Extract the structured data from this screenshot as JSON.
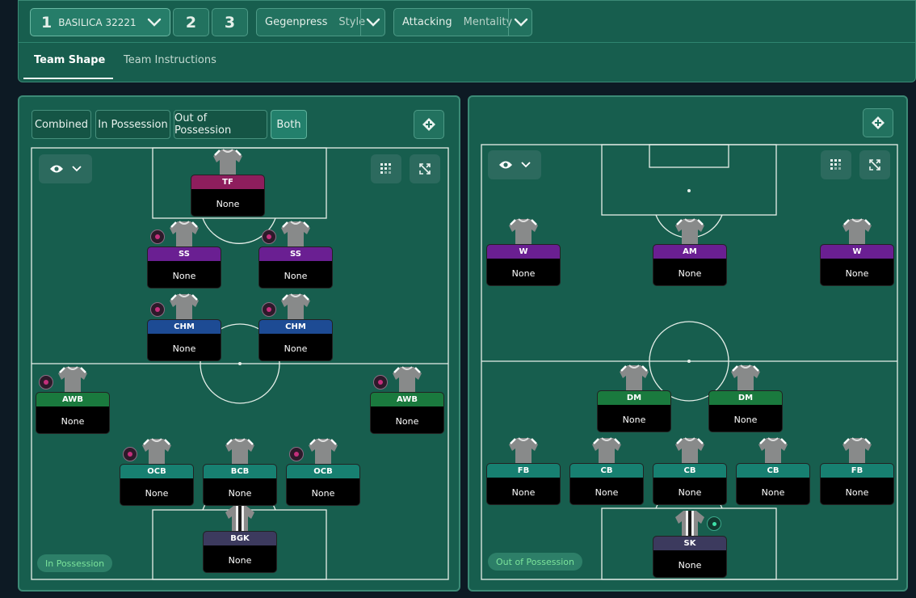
{
  "topbar": {
    "tactic_slot_1": {
      "number": "1",
      "name": "BASILICA 32221"
    },
    "tactic_slot_2": "2",
    "tactic_slot_3": "3",
    "style": {
      "value": "Gegenpress",
      "label": "Style"
    },
    "mentality": {
      "value": "Attacking",
      "label": "Mentality"
    }
  },
  "tabs": [
    "Team Shape",
    "Team Instructions"
  ],
  "view_modes": [
    "Combined",
    "In Possession",
    "Out of Possession",
    "Both"
  ],
  "active_view_mode": "Both",
  "left_pitch": {
    "label": "In Possession",
    "players": [
      {
        "role": "TF",
        "name": "None",
        "role_color": "#8e1e5d",
        "duty": false
      },
      {
        "role": "SS",
        "name": "None",
        "role_color": "#6a1f92",
        "duty": true
      },
      {
        "role": "SS",
        "name": "None",
        "role_color": "#6a1f92",
        "duty": true
      },
      {
        "role": "CHM",
        "name": "None",
        "role_color": "#1d4b94",
        "duty": true
      },
      {
        "role": "CHM",
        "name": "None",
        "role_color": "#1d4b94",
        "duty": true
      },
      {
        "role": "AWB",
        "name": "None",
        "role_color": "#1a7a3e",
        "duty": true
      },
      {
        "role": "AWB",
        "name": "None",
        "role_color": "#1a7a3e",
        "duty": true
      },
      {
        "role": "OCB",
        "name": "None",
        "role_color": "#178071",
        "duty": true
      },
      {
        "role": "BCB",
        "name": "None",
        "role_color": "#178071",
        "duty": false
      },
      {
        "role": "OCB",
        "name": "None",
        "role_color": "#178071",
        "duty": true
      },
      {
        "role": "BGK",
        "name": "None",
        "role_color": "#3c3a5e",
        "duty": false,
        "gk": true
      }
    ]
  },
  "right_pitch": {
    "label": "Out of Possession",
    "players": [
      {
        "role": "W",
        "name": "None",
        "role_color": "#6a1f92"
      },
      {
        "role": "AM",
        "name": "None",
        "role_color": "#6a1f92"
      },
      {
        "role": "W",
        "name": "None",
        "role_color": "#6a1f92"
      },
      {
        "role": "DM",
        "name": "None",
        "role_color": "#1a7a3e"
      },
      {
        "role": "DM",
        "name": "None",
        "role_color": "#1a7a3e"
      },
      {
        "role": "FB",
        "name": "None",
        "role_color": "#178071"
      },
      {
        "role": "CB",
        "name": "None",
        "role_color": "#178071"
      },
      {
        "role": "CB",
        "name": "None",
        "role_color": "#178071"
      },
      {
        "role": "CB",
        "name": "None",
        "role_color": "#178071"
      },
      {
        "role": "FB",
        "name": "None",
        "role_color": "#178071"
      },
      {
        "role": "SK",
        "name": "None",
        "role_color": "#3c3a5e",
        "gk": true
      }
    ]
  },
  "colors": {
    "panel": "#175e4e",
    "border": "#3c8a76",
    "accent": "#23806c",
    "label_text": "#7be39b"
  },
  "icons": [
    "chevron-down-icon",
    "eye-icon",
    "grid-icon",
    "expand-icon",
    "swap-icon",
    "shirt-icon",
    "duty-icon"
  ]
}
